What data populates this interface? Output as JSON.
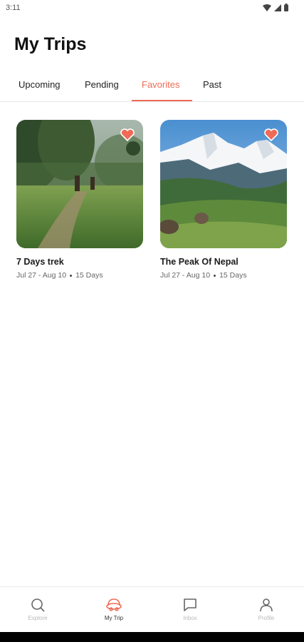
{
  "status_bar": {
    "time": "3:11"
  },
  "header": {
    "title": "My Trips"
  },
  "tabs": [
    {
      "label": "Upcoming",
      "active": false
    },
    {
      "label": "Pending",
      "active": false
    },
    {
      "label": "Favorites",
      "active": true
    },
    {
      "label": "Past",
      "active": false
    }
  ],
  "trips": [
    {
      "title": "7 Days trek",
      "dates": "Jul 27 - Aug 10",
      "duration": "15 Days",
      "favorite": true,
      "image": "forest-trail-with-horse-riders"
    },
    {
      "title": "The Peak Of Nepal",
      "dates": "Jul 27 - Aug 10",
      "duration": "15 Days",
      "favorite": true,
      "image": "snowy-mountain-peaks-green-hills"
    }
  ],
  "bottom_nav": [
    {
      "label": "Explore",
      "icon": "search-icon",
      "active": false
    },
    {
      "label": "My Trip",
      "icon": "trip-icon",
      "active": true
    },
    {
      "label": "Inbox",
      "icon": "chat-icon",
      "active": false
    },
    {
      "label": "Profile",
      "icon": "user-icon",
      "active": false
    }
  ],
  "colors": {
    "accent": "#ef6b57"
  }
}
